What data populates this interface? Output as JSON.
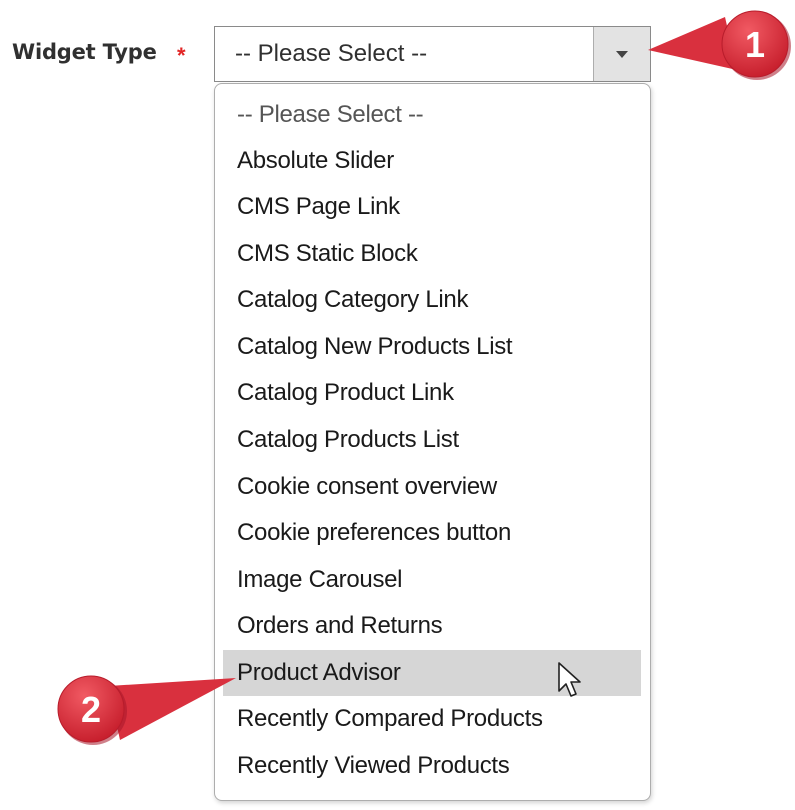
{
  "form": {
    "widget_type_label": "Widget Type",
    "required_marker": "*",
    "select_value": "-- Please Select --"
  },
  "dropdown": {
    "options": [
      "-- Please Select --",
      "Absolute Slider",
      "CMS Page Link",
      "CMS Static Block",
      "Catalog Category Link",
      "Catalog New Products List",
      "Catalog Product Link",
      "Catalog Products List",
      "Cookie consent overview",
      "Cookie preferences button",
      "Image Carousel",
      "Orders and Returns",
      "Product Advisor",
      "Recently Compared Products",
      "Recently Viewed Products"
    ],
    "hovered_option": "Product Advisor"
  },
  "callouts": {
    "first": "1",
    "second": "2"
  },
  "colors": {
    "callout_red": "#d9303e",
    "required_red": "#e22626",
    "hover_gray": "#d6d6d6"
  },
  "icons": {
    "select_toggle": "triangle-down-icon",
    "cursor": "mouse-pointer-icon"
  }
}
